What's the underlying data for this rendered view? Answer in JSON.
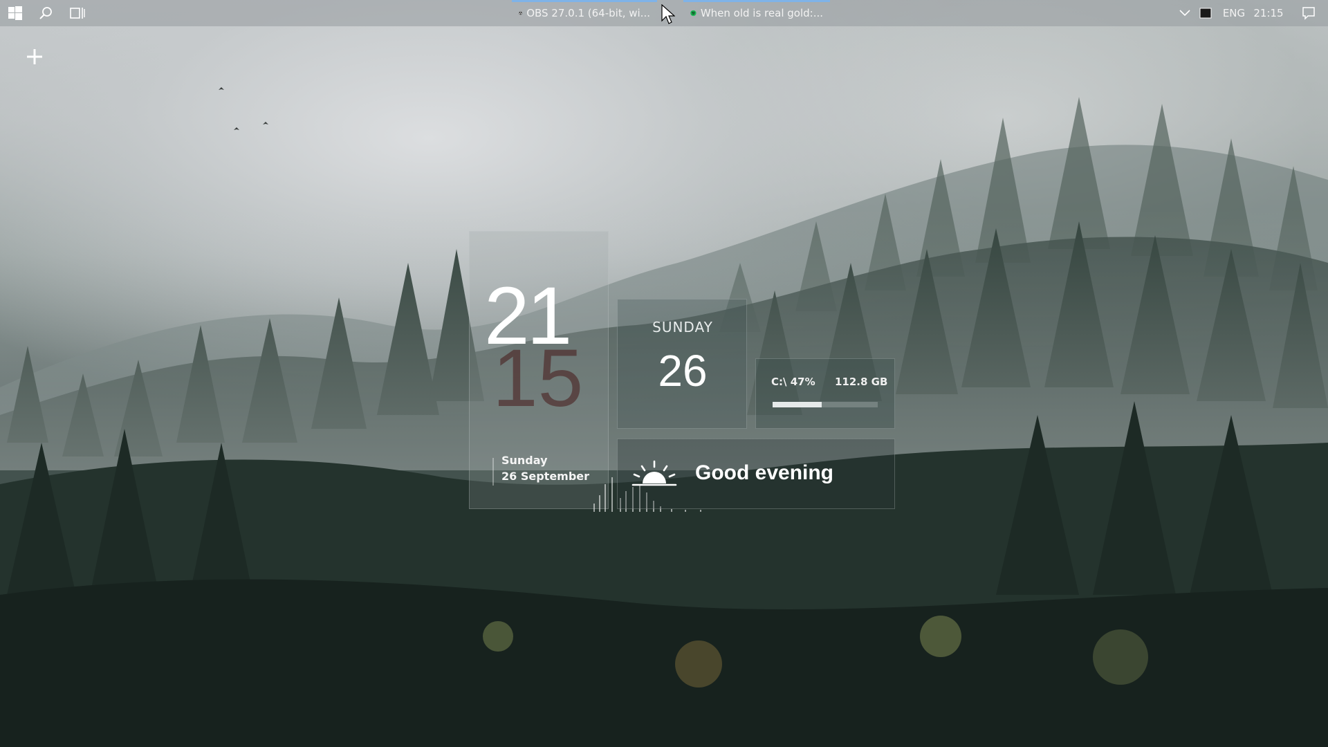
{
  "taskbar": {
    "apps": [
      {
        "label": "OBS 27.0.1 (64-bit, wi...",
        "icon": "obs-icon"
      },
      {
        "label": "When old is real gold:...",
        "icon": "spotify-icon"
      }
    ],
    "tray": {
      "language": "ENG",
      "time": "21:15"
    }
  },
  "widgets": {
    "clock": {
      "hour": "21",
      "minute": "15",
      "day": "Sunday",
      "date": "26 September"
    },
    "day_card": {
      "weekday": "SUNDAY",
      "day_number": "26"
    },
    "disk": {
      "label": "C:\\ 47%",
      "size": "112.8 GB",
      "usage_fraction": 0.47
    },
    "greeting": {
      "text": "Good evening"
    }
  },
  "colors": {
    "taskbar_accent": "#7fb3e8",
    "spotify_green": "#1db954",
    "minute_tint": "#5a1e1e"
  }
}
